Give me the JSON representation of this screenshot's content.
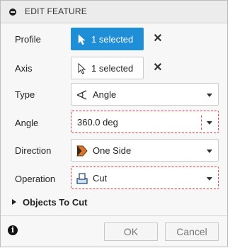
{
  "header": {
    "title": "EDIT FEATURE"
  },
  "rows": {
    "profile": {
      "label": "Profile",
      "value": "1 selected",
      "clear": "✕"
    },
    "axis": {
      "label": "Axis",
      "value": "1 selected",
      "clear": "✕"
    },
    "type": {
      "label": "Type",
      "value": "Angle"
    },
    "angle": {
      "label": "Angle",
      "value": "360.0 deg"
    },
    "direction": {
      "label": "Direction",
      "value": "One Side"
    },
    "operation": {
      "label": "Operation",
      "value": "Cut"
    }
  },
  "section": {
    "label": "Objects To Cut"
  },
  "footer": {
    "info": "i",
    "ok": "OK",
    "cancel": "Cancel"
  },
  "colors": {
    "accent": "#1e8fd6",
    "highlight_border": "#e03a3a",
    "direction_icon": "#d9752b"
  },
  "icons": [
    "collapse-dot-icon",
    "cursor-arrow-icon",
    "close-icon",
    "angle-icon",
    "direction-icon",
    "cut-icon",
    "chevron-down-icon",
    "expand-triangle-icon",
    "info-icon"
  ]
}
